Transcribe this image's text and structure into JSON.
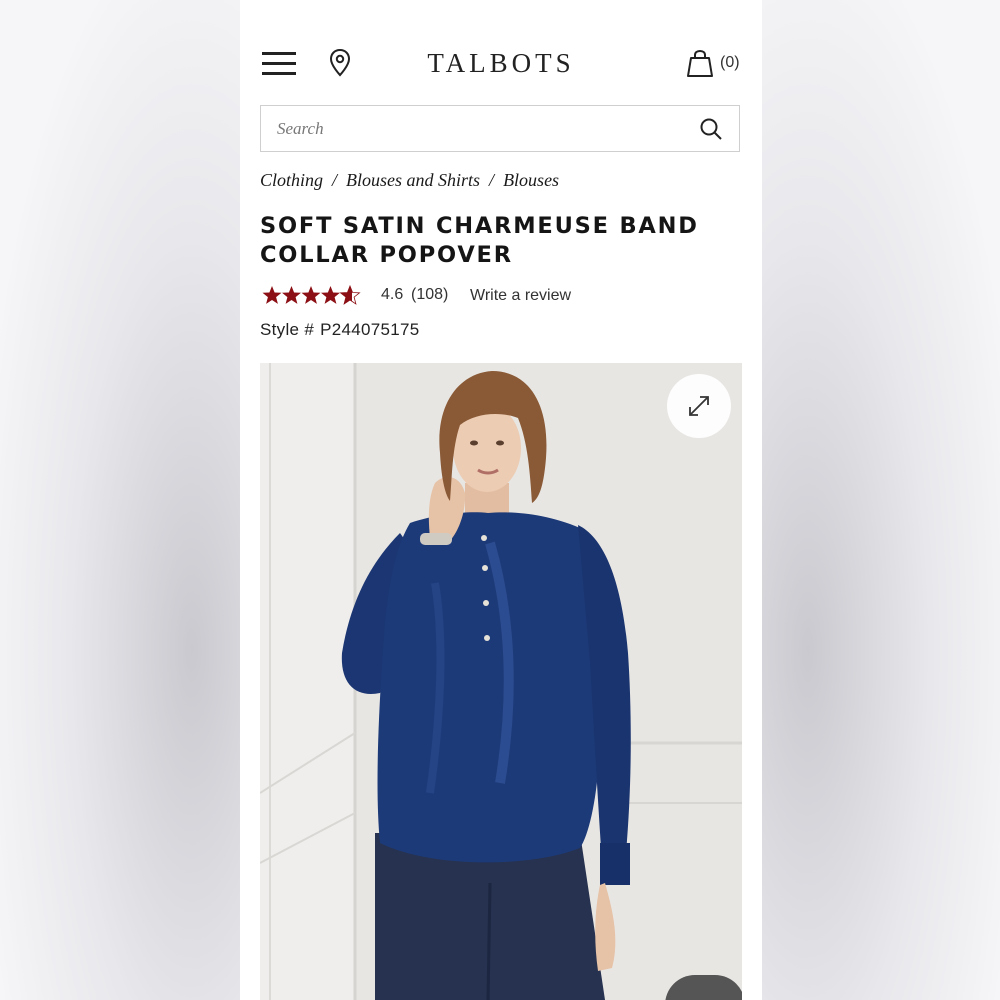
{
  "header": {
    "logo": "TALBOTS",
    "bag_count": "(0)"
  },
  "search": {
    "placeholder": "Search"
  },
  "breadcrumb": [
    "Clothing",
    "Blouses and Shirts",
    "Blouses"
  ],
  "product": {
    "title": "SOFT SATIN CHARMEUSE BAND COLLAR POPOVER",
    "rating": 4.6,
    "rating_value": "4.6",
    "review_count": "(108)",
    "write_review_label": "Write a review",
    "style_label": "Style #",
    "style_number": "P244075175"
  },
  "colors": {
    "star": "#8b0f14",
    "blouse": "#1d3a78",
    "jeans": "#26324f",
    "hair": "#8a5a36",
    "skin": "#e9c7ad",
    "background": "#e9e7e4"
  },
  "icons": {
    "menu": "hamburger-icon",
    "location": "map-pin-icon",
    "bag": "shopping-bag-icon",
    "search": "magnifier-icon",
    "zoom": "expand-arrows-icon",
    "star": "star-icon"
  }
}
